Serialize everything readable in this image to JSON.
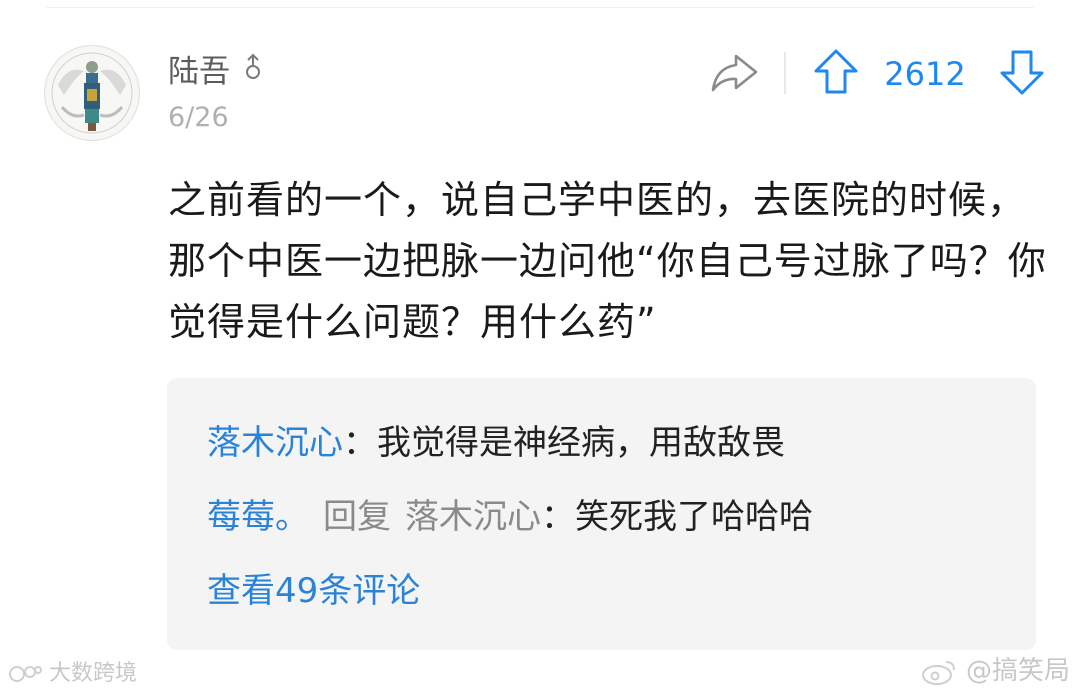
{
  "post": {
    "username": "陆吾",
    "gender_icon": "male-symbol-icon",
    "date": "6/26",
    "vote_count": "2612",
    "content": "之前看的一个，说自己学中医的，去医院的时候，那个中医一边把脉一边问他“你自己号过脉了吗？你觉得是什么问题？用什么药”"
  },
  "replies": [
    {
      "author": "落木沉心",
      "separator": "：",
      "text": "我觉得是神经病，用敌敌畏"
    },
    {
      "author": "莓莓。",
      "reply_word": "回复",
      "reply_to": "落木沉心",
      "separator": "：",
      "text": "笑死我了哈哈哈"
    }
  ],
  "view_comments": "查看49条评论",
  "watermarks": {
    "left": "大数跨境",
    "right": "@搞笑局"
  },
  "colors": {
    "accent": "#1e87f0",
    "link": "#2a83d7",
    "reply_bg": "#f4f4f4",
    "muted": "#b0b0b0"
  }
}
